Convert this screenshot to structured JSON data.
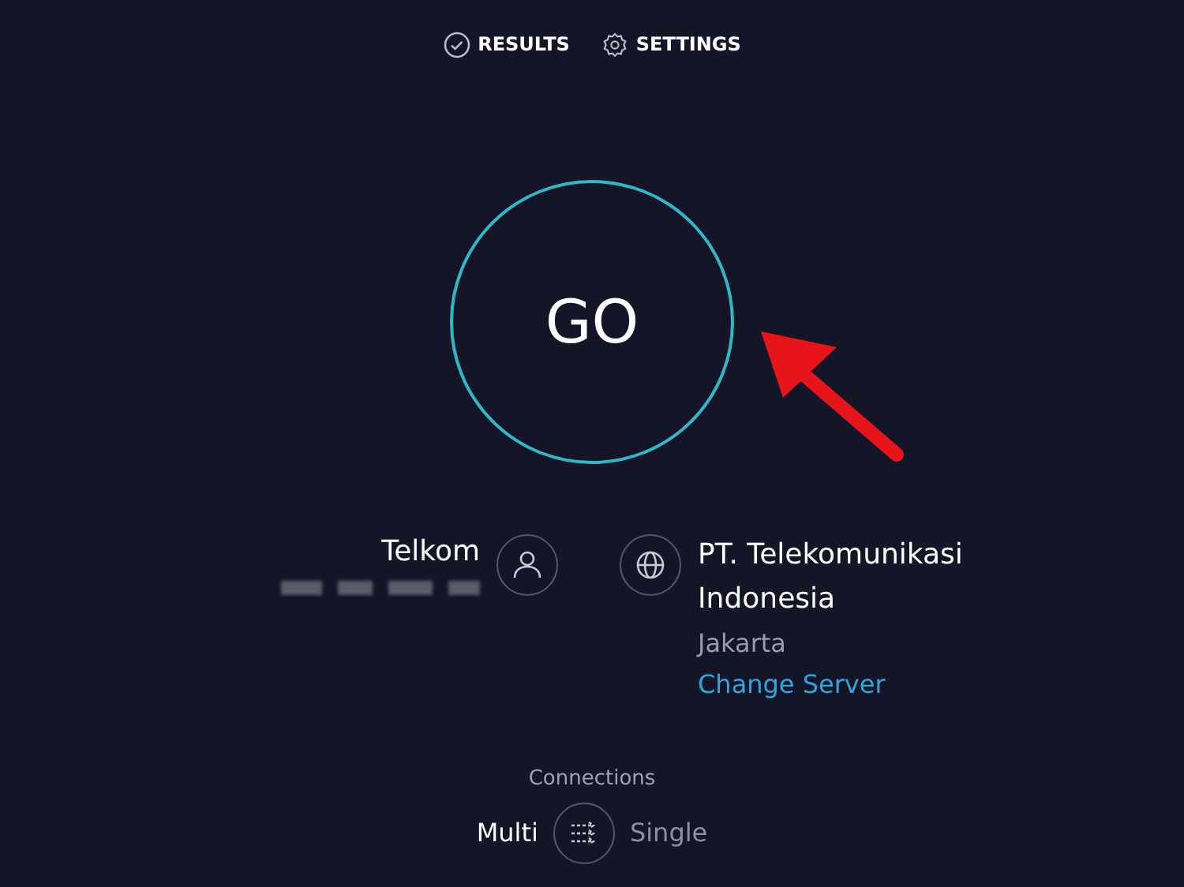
{
  "nav": [
    {
      "kind": "results",
      "label": "RESULTS"
    },
    {
      "kind": "settings",
      "label": "SETTINGS"
    }
  ],
  "start_button": {
    "label": "GO"
  },
  "provider": {
    "name": "Telkom"
  },
  "server": {
    "name": "PT. Telekomunikasi Indonesia",
    "location": "Jakarta",
    "link": "Change Server"
  },
  "connections": {
    "title": "Connections",
    "options": [
      {
        "label": "Multi",
        "selected": true
      },
      {
        "label": "Single",
        "selected": false
      }
    ]
  }
}
